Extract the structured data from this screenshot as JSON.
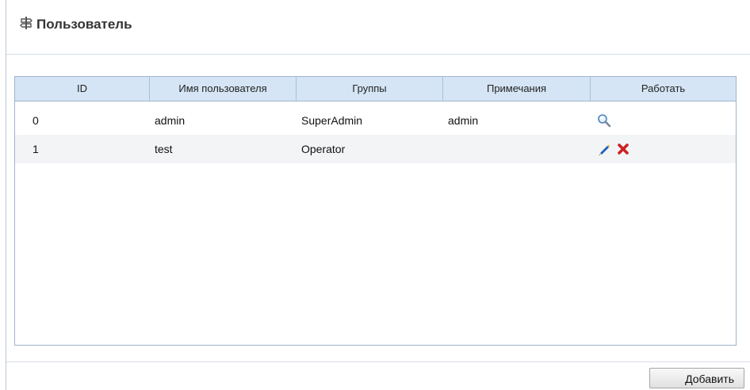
{
  "panel": {
    "title": "Пользователь",
    "title_icon": "signpost-icon"
  },
  "table": {
    "columns": [
      "ID",
      "Имя пользователя",
      "Группы",
      "Примечания",
      "Работать"
    ],
    "rows": [
      {
        "id": "0",
        "username": "admin",
        "group": "SuperAdmin",
        "notes": "admin",
        "actions": [
          "view-icon"
        ]
      },
      {
        "id": "1",
        "username": "test",
        "group": "Operator",
        "notes": "",
        "actions": [
          "edit-icon",
          "delete-icon"
        ]
      }
    ]
  },
  "footer": {
    "add_button_label": "Добавить"
  },
  "colors": {
    "header_bg": "#d5e5f5",
    "border": "#9fb3cc",
    "alt_row": "#f3f4f6",
    "delete_red": "#cc2222",
    "edit_blue": "#1f5fbf"
  }
}
